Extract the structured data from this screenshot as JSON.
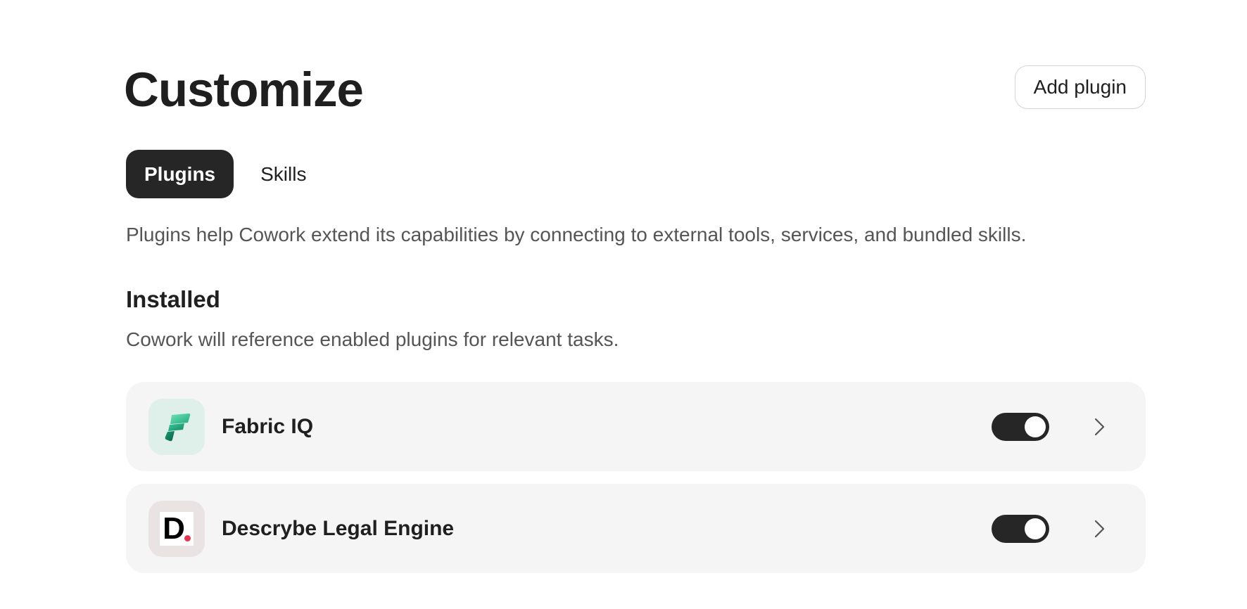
{
  "header": {
    "title": "Customize",
    "add_plugin_label": "Add plugin"
  },
  "tabs": [
    {
      "label": "Plugins",
      "active": true
    },
    {
      "label": "Skills",
      "active": false
    }
  ],
  "description": "Plugins help Cowork extend its capabilities by connecting to external tools, services, and bundled skills.",
  "installed": {
    "title": "Installed",
    "subtitle": "Cowork will reference enabled plugins for relevant tasks.",
    "plugins": [
      {
        "name": "Fabric IQ",
        "icon": "fabric-iq-logo",
        "enabled": true
      },
      {
        "name": "Descrybe Legal Engine",
        "icon": "descrybe-logo",
        "icon_letter": "D",
        "enabled": true
      }
    ]
  },
  "colors": {
    "accent_dark": "#262626",
    "card_background": "#f5f5f5",
    "muted_text": "#555555",
    "descrybe_dot": "#e8334f"
  }
}
